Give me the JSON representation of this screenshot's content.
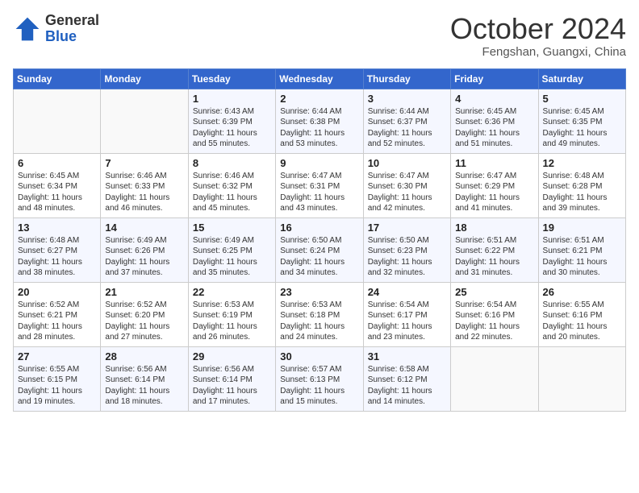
{
  "header": {
    "logo_general": "General",
    "logo_blue": "Blue",
    "month_title": "October 2024",
    "location": "Fengshan, Guangxi, China"
  },
  "weekdays": [
    "Sunday",
    "Monday",
    "Tuesday",
    "Wednesday",
    "Thursday",
    "Friday",
    "Saturday"
  ],
  "weeks": [
    [
      {
        "day": "",
        "sunrise": "",
        "sunset": "",
        "daylight": ""
      },
      {
        "day": "",
        "sunrise": "",
        "sunset": "",
        "daylight": ""
      },
      {
        "day": "1",
        "sunrise": "Sunrise: 6:43 AM",
        "sunset": "Sunset: 6:39 PM",
        "daylight": "Daylight: 11 hours and 55 minutes."
      },
      {
        "day": "2",
        "sunrise": "Sunrise: 6:44 AM",
        "sunset": "Sunset: 6:38 PM",
        "daylight": "Daylight: 11 hours and 53 minutes."
      },
      {
        "day": "3",
        "sunrise": "Sunrise: 6:44 AM",
        "sunset": "Sunset: 6:37 PM",
        "daylight": "Daylight: 11 hours and 52 minutes."
      },
      {
        "day": "4",
        "sunrise": "Sunrise: 6:45 AM",
        "sunset": "Sunset: 6:36 PM",
        "daylight": "Daylight: 11 hours and 51 minutes."
      },
      {
        "day": "5",
        "sunrise": "Sunrise: 6:45 AM",
        "sunset": "Sunset: 6:35 PM",
        "daylight": "Daylight: 11 hours and 49 minutes."
      }
    ],
    [
      {
        "day": "6",
        "sunrise": "Sunrise: 6:45 AM",
        "sunset": "Sunset: 6:34 PM",
        "daylight": "Daylight: 11 hours and 48 minutes."
      },
      {
        "day": "7",
        "sunrise": "Sunrise: 6:46 AM",
        "sunset": "Sunset: 6:33 PM",
        "daylight": "Daylight: 11 hours and 46 minutes."
      },
      {
        "day": "8",
        "sunrise": "Sunrise: 6:46 AM",
        "sunset": "Sunset: 6:32 PM",
        "daylight": "Daylight: 11 hours and 45 minutes."
      },
      {
        "day": "9",
        "sunrise": "Sunrise: 6:47 AM",
        "sunset": "Sunset: 6:31 PM",
        "daylight": "Daylight: 11 hours and 43 minutes."
      },
      {
        "day": "10",
        "sunrise": "Sunrise: 6:47 AM",
        "sunset": "Sunset: 6:30 PM",
        "daylight": "Daylight: 11 hours and 42 minutes."
      },
      {
        "day": "11",
        "sunrise": "Sunrise: 6:47 AM",
        "sunset": "Sunset: 6:29 PM",
        "daylight": "Daylight: 11 hours and 41 minutes."
      },
      {
        "day": "12",
        "sunrise": "Sunrise: 6:48 AM",
        "sunset": "Sunset: 6:28 PM",
        "daylight": "Daylight: 11 hours and 39 minutes."
      }
    ],
    [
      {
        "day": "13",
        "sunrise": "Sunrise: 6:48 AM",
        "sunset": "Sunset: 6:27 PM",
        "daylight": "Daylight: 11 hours and 38 minutes."
      },
      {
        "day": "14",
        "sunrise": "Sunrise: 6:49 AM",
        "sunset": "Sunset: 6:26 PM",
        "daylight": "Daylight: 11 hours and 37 minutes."
      },
      {
        "day": "15",
        "sunrise": "Sunrise: 6:49 AM",
        "sunset": "Sunset: 6:25 PM",
        "daylight": "Daylight: 11 hours and 35 minutes."
      },
      {
        "day": "16",
        "sunrise": "Sunrise: 6:50 AM",
        "sunset": "Sunset: 6:24 PM",
        "daylight": "Daylight: 11 hours and 34 minutes."
      },
      {
        "day": "17",
        "sunrise": "Sunrise: 6:50 AM",
        "sunset": "Sunset: 6:23 PM",
        "daylight": "Daylight: 11 hours and 32 minutes."
      },
      {
        "day": "18",
        "sunrise": "Sunrise: 6:51 AM",
        "sunset": "Sunset: 6:22 PM",
        "daylight": "Daylight: 11 hours and 31 minutes."
      },
      {
        "day": "19",
        "sunrise": "Sunrise: 6:51 AM",
        "sunset": "Sunset: 6:21 PM",
        "daylight": "Daylight: 11 hours and 30 minutes."
      }
    ],
    [
      {
        "day": "20",
        "sunrise": "Sunrise: 6:52 AM",
        "sunset": "Sunset: 6:21 PM",
        "daylight": "Daylight: 11 hours and 28 minutes."
      },
      {
        "day": "21",
        "sunrise": "Sunrise: 6:52 AM",
        "sunset": "Sunset: 6:20 PM",
        "daylight": "Daylight: 11 hours and 27 minutes."
      },
      {
        "day": "22",
        "sunrise": "Sunrise: 6:53 AM",
        "sunset": "Sunset: 6:19 PM",
        "daylight": "Daylight: 11 hours and 26 minutes."
      },
      {
        "day": "23",
        "sunrise": "Sunrise: 6:53 AM",
        "sunset": "Sunset: 6:18 PM",
        "daylight": "Daylight: 11 hours and 24 minutes."
      },
      {
        "day": "24",
        "sunrise": "Sunrise: 6:54 AM",
        "sunset": "Sunset: 6:17 PM",
        "daylight": "Daylight: 11 hours and 23 minutes."
      },
      {
        "day": "25",
        "sunrise": "Sunrise: 6:54 AM",
        "sunset": "Sunset: 6:16 PM",
        "daylight": "Daylight: 11 hours and 22 minutes."
      },
      {
        "day": "26",
        "sunrise": "Sunrise: 6:55 AM",
        "sunset": "Sunset: 6:16 PM",
        "daylight": "Daylight: 11 hours and 20 minutes."
      }
    ],
    [
      {
        "day": "27",
        "sunrise": "Sunrise: 6:55 AM",
        "sunset": "Sunset: 6:15 PM",
        "daylight": "Daylight: 11 hours and 19 minutes."
      },
      {
        "day": "28",
        "sunrise": "Sunrise: 6:56 AM",
        "sunset": "Sunset: 6:14 PM",
        "daylight": "Daylight: 11 hours and 18 minutes."
      },
      {
        "day": "29",
        "sunrise": "Sunrise: 6:56 AM",
        "sunset": "Sunset: 6:14 PM",
        "daylight": "Daylight: 11 hours and 17 minutes."
      },
      {
        "day": "30",
        "sunrise": "Sunrise: 6:57 AM",
        "sunset": "Sunset: 6:13 PM",
        "daylight": "Daylight: 11 hours and 15 minutes."
      },
      {
        "day": "31",
        "sunrise": "Sunrise: 6:58 AM",
        "sunset": "Sunset: 6:12 PM",
        "daylight": "Daylight: 11 hours and 14 minutes."
      },
      {
        "day": "",
        "sunrise": "",
        "sunset": "",
        "daylight": ""
      },
      {
        "day": "",
        "sunrise": "",
        "sunset": "",
        "daylight": ""
      }
    ]
  ]
}
